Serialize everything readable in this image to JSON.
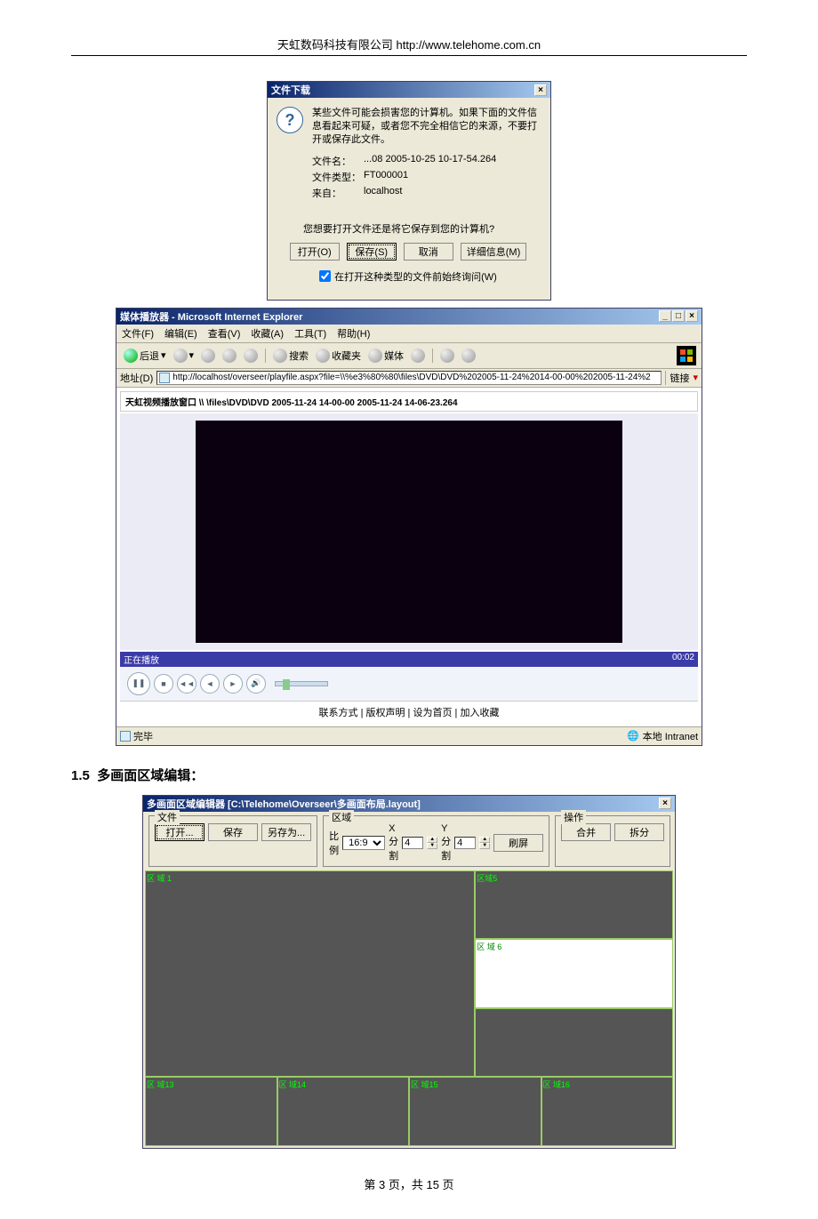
{
  "header": {
    "company": "天虹数码科技有限公司 http://www.telehome.com.cn"
  },
  "dialog1": {
    "title": "文件下载",
    "closeX": "×",
    "warning": "某些文件可能会损害您的计算机。如果下面的文件信息看起来可疑，或者您不完全相信它的来源，不要打开或保存此文件。",
    "filename_label": "文件名：",
    "filename_value": "...08 2005-10-25 10-17-54.264",
    "filetype_label": "文件类型：",
    "filetype_value": "FT000001",
    "source_label": "来自：",
    "source_value": "localhost",
    "question": "您想要打开文件还是将它保存到您的计算机?",
    "btn_open": "打开(O)",
    "btn_save": "保存(S)",
    "btn_cancel": "取消",
    "btn_more": "详细信息(M)",
    "checkbox": "在打开这种类型的文件前始终询问(W)"
  },
  "ie": {
    "title": "媒体播放器 - Microsoft Internet Explorer",
    "menu": [
      "文件(F)",
      "编辑(E)",
      "查看(V)",
      "收藏(A)",
      "工具(T)",
      "帮助(H)"
    ],
    "back": "后退",
    "search": "搜索",
    "favorites": "收藏夹",
    "media": "媒体",
    "addr_label": "地址(D)",
    "addr_url": "http://localhost/overseer/playfile.aspx?file=\\\\%e3%80%80\\files\\DVD\\DVD%202005-11-24%2014-00-00%202005-11-24%2",
    "links": "链接",
    "player_title": "天虹视频播放窗口  \\\\  \\files\\DVD\\DVD 2005-11-24 14-00-00 2005-11-24 14-06-23.264",
    "status_play": "正在播放",
    "status_time": "00:02",
    "footer_links": "联系方式 | 版权声明 | 设为首页 | 加入收藏",
    "status_done": "完毕",
    "status_zone": "本地 Intranet"
  },
  "section": {
    "num": "1.5",
    "title": "多画面区域编辑："
  },
  "layout": {
    "title": "多画面区域编辑器 [C:\\Telehome\\Overseer\\多画面布局.layout]",
    "grp_file": "文件",
    "btn_open": "打开...",
    "btn_save": "保存",
    "btn_saveas": "另存为...",
    "grp_region": "区域",
    "ratio_label": "比例",
    "ratio_value": "16:9",
    "xsplit": "X分割",
    "xval": "4",
    "ysplit": "Y分割",
    "yval": "4",
    "btn_refresh": "刷屏",
    "grp_op": "操作",
    "btn_merge": "合并",
    "btn_split": "拆分",
    "regions": {
      "r1": "区\n域\n1",
      "r5": "区域5",
      "r6": "区\n域\n6",
      "r13": "区\n域13",
      "r14": "区\n域14",
      "r15": "区\n域15",
      "r16": "区\n域16"
    }
  },
  "footer": {
    "page": "第 3 页，共 15 页"
  }
}
